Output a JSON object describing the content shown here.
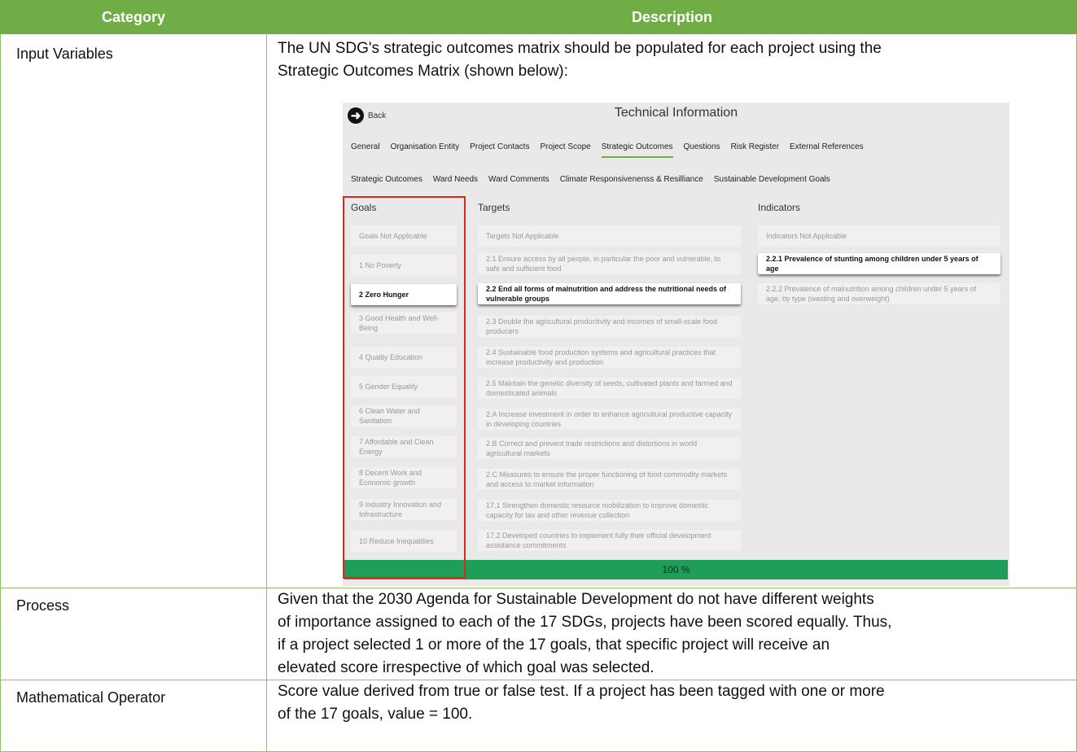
{
  "table": {
    "header": {
      "category": "Category",
      "description": "Description"
    },
    "rows": [
      {
        "label": "Input Variables",
        "lines": [
          "The UN SDG's strategic outcomes matrix should be populated for each project using the",
          "Strategic Outcomes Matrix (shown below):"
        ]
      },
      {
        "label": "Process",
        "lines": [
          "Given that the 2030 Agenda for Sustainable Development do not have different weights",
          "of importance assigned to each of the 17 SDGs, projects have been scored equally. Thus,",
          "if a project selected 1 or more of the 17 goals, that specific project will receive an",
          "elevated score irrespective of which goal was selected."
        ]
      },
      {
        "label": "Mathematical Operator",
        "lines": [
          "Score value derived from true or false test. If a project has been tagged with one or more",
          "of the 17 goals, value = 100."
        ]
      }
    ]
  },
  "screenshot": {
    "back_label": "Back",
    "title": "Technical Information",
    "tabs_primary": [
      "General",
      "Organisation Entity",
      "Project Contacts",
      "Project Scope",
      "Strategic Outcomes",
      "Questions",
      "Risk Register",
      "External References"
    ],
    "tabs_secondary": [
      "Strategic Outcomes",
      "Ward Needs",
      "Ward Comments",
      "Climate Responsivenenss & Resilliance",
      "Sustainable Development Goals"
    ],
    "columns": {
      "goals": "Goals",
      "targets": "Targets",
      "indicators": "Indicators"
    },
    "goals": [
      "Goals Not Applicable",
      "1 No Poverty",
      "2 Zero Hunger",
      "3 Good Health and Well-Being",
      "4 Quality Education",
      "5 Gender Equality",
      "6 Clean Water and Sanitation",
      "7 Affordable and Clean Energy",
      "8 Decent Work and Economic growth",
      "9 Industry Innovation and Infrastructure",
      "10 Reduce Inequalities"
    ],
    "targets": [
      "Targets Not Applicable",
      "2.1 Ensure access by all people, in particular the poor and vulnerable, to safe and sufficient food",
      "2.2 End all forms of malnutrition and address the nutritional needs of vulnerable groups",
      "2.3 Double the agricultural productivity and incomes of small-scale food producers",
      "2.4 Sustainable food production systems and agricultural practices that increase productivity and production",
      "2.5 Maintain the genetic diversity of seeds, cultivated plants and farmed and domesticated animals",
      "2.A Increase investment in order to enhance agricultural productive capacity in developing countries",
      "2.B Correct and prevent trade restrictions and distortions in world agricultural markets",
      "2.C Measures to ensure the proper functioning of food commodity markets and access to market information",
      "17.1 Strengthen domestic resource mobilization to improve domestic capacity for tax and other revenue collection",
      "17.2 Developed countries to implement fully their official development assistance commitments"
    ],
    "indicators": [
      "Indicators Not Applicable",
      "2.2.1 Prevalence of stunting among children under 5 years of age",
      "2.2.2 Prevalence of malnutrition among children under 5 years of age, by type (wasting and overweight)"
    ],
    "progress_label": "100 %",
    "progress_value": 100,
    "colors": {
      "header_green": "#70ad47",
      "progress_green": "#1f9e5a",
      "highlight_red": "#e0251d"
    }
  }
}
